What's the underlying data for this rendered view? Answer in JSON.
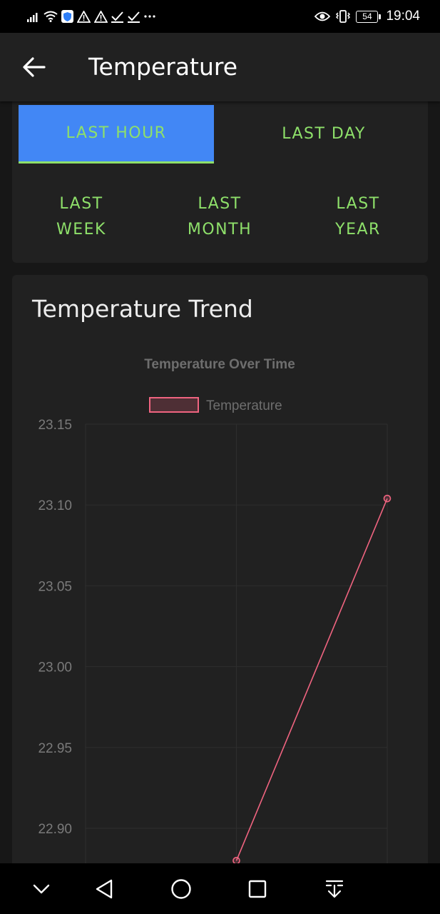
{
  "status_bar": {
    "time": "19:04",
    "battery": "54",
    "left_icons": [
      "signal-icon",
      "wifi-icon",
      "shield-icon",
      "warning-icon",
      "warning-icon",
      "check-icon",
      "check-icon",
      "more-icon"
    ],
    "right_icons": [
      "eye-icon",
      "vibrate-icon",
      "battery-icon"
    ]
  },
  "app_bar": {
    "title": "Temperature",
    "back_icon": "arrow-left-icon"
  },
  "range_selector": {
    "options": [
      {
        "id": "last-hour",
        "lines": [
          "LAST HOUR"
        ],
        "active": true
      },
      {
        "id": "last-day",
        "lines": [
          "LAST DAY"
        ],
        "active": false
      },
      {
        "id": "last-week",
        "lines": [
          "LAST",
          "WEEK"
        ],
        "active": false
      },
      {
        "id": "last-month",
        "lines": [
          "LAST",
          "MONTH"
        ],
        "active": false
      },
      {
        "id": "last-year",
        "lines": [
          "LAST",
          "YEAR"
        ],
        "active": false
      }
    ]
  },
  "chart_card": {
    "heading": "Temperature Trend"
  },
  "chart_data": {
    "type": "line",
    "title": "Temperature Over Time",
    "legend_position": "top",
    "grid": true,
    "y_ticks": [
      "23.15",
      "23.10",
      "23.05",
      "23.00",
      "22.95",
      "22.90"
    ],
    "ylim": [
      22.9,
      23.15
    ],
    "x_count": 3,
    "series": [
      {
        "name": "Temperature",
        "color": "#f06480",
        "points": [
          {
            "x": 1,
            "y": 22.88
          },
          {
            "x": 2,
            "y": 23.104
          }
        ]
      }
    ]
  },
  "colors": {
    "accent": "#4287f5",
    "range_text": "#8ee06a",
    "line": "#f06480",
    "background": "#171717",
    "card": "#212121"
  },
  "nav_bar": {
    "icons": [
      "chevron-down-icon",
      "back-triangle-icon",
      "home-circle-icon",
      "recents-square-icon",
      "notification-pull-icon"
    ]
  }
}
